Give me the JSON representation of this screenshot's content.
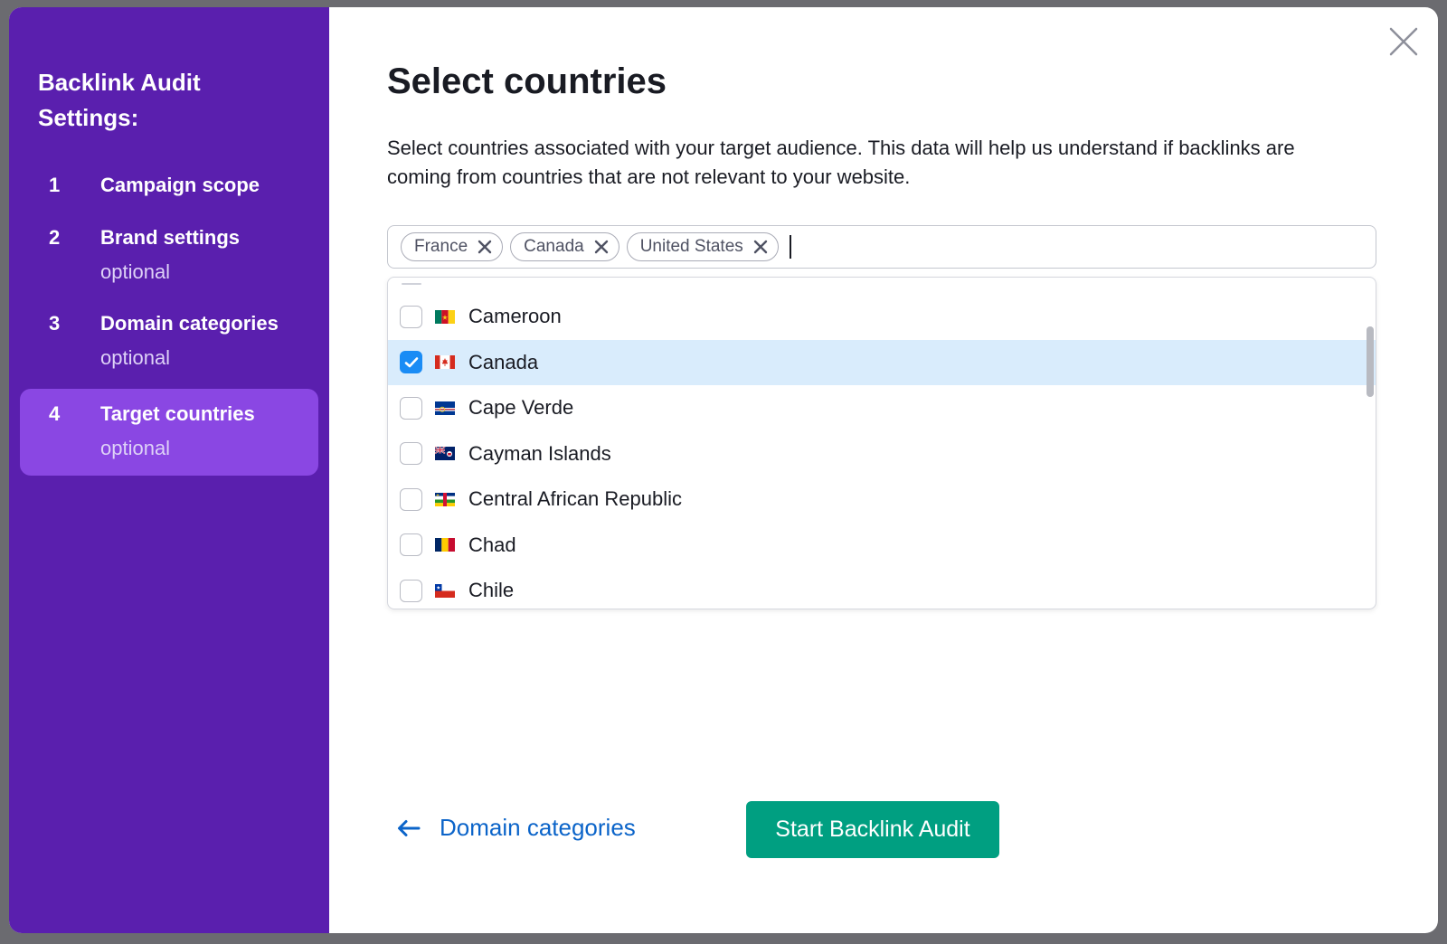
{
  "sidebar": {
    "title": "Backlink Audit Settings:",
    "steps": [
      {
        "number": "1",
        "label": "Campaign scope",
        "optional": ""
      },
      {
        "number": "2",
        "label": "Brand settings",
        "optional": "optional"
      },
      {
        "number": "3",
        "label": "Domain categories",
        "optional": "optional"
      },
      {
        "number": "4",
        "label": "Target countries",
        "optional": "optional",
        "active": true
      }
    ],
    "colors": {
      "background": "#5a1fae",
      "active_step": "#8a47e3"
    }
  },
  "main": {
    "title": "Select countries",
    "description": "Select countries associated with your target audience. This data will help us understand if backlinks are coming from countries that are not relevant to your website.",
    "selected_tags": [
      "France",
      "Canada",
      "United States"
    ],
    "options": [
      {
        "name": "Cameroon",
        "checked": false,
        "flag": "cameroon-flag-icon"
      },
      {
        "name": "Canada",
        "checked": true,
        "flag": "canada-flag-icon"
      },
      {
        "name": "Cape Verde",
        "checked": false,
        "flag": "cape-verde-flag-icon"
      },
      {
        "name": "Cayman Islands",
        "checked": false,
        "flag": "cayman-islands-flag-icon"
      },
      {
        "name": "Central African Republic",
        "checked": false,
        "flag": "central-african-republic-flag-icon"
      },
      {
        "name": "Chad",
        "checked": false,
        "flag": "chad-flag-icon"
      },
      {
        "name": "Chile",
        "checked": false,
        "flag": "chile-flag-icon"
      }
    ],
    "back_link_label": "Domain categories",
    "start_button_label": "Start Backlink Audit",
    "colors": {
      "primary_button": "#009f81",
      "link": "#0b64c9",
      "selected_row": "#d9ecfc",
      "checkbox_checked": "#1a8cf5"
    }
  }
}
